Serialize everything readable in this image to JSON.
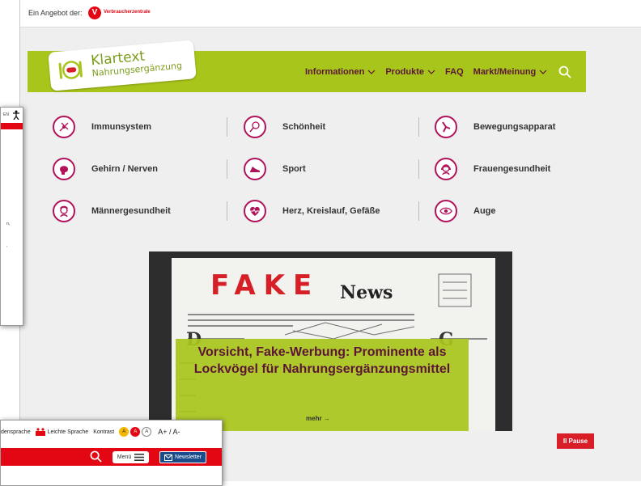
{
  "topbar": {
    "offer_text": "Ein Angebot der:",
    "org_name": "Verbraucherzentrale",
    "logo_letter": "V"
  },
  "header": {
    "logo_line1": "Klartext",
    "logo_line2": "Nahrungsergänzung",
    "brand_color": "#a8c51b",
    "nav": [
      {
        "label": "Informationen",
        "has_dropdown": true
      },
      {
        "label": "Produkte",
        "has_dropdown": true
      },
      {
        "label": "FAQ",
        "has_dropdown": false
      },
      {
        "label": "Markt/Meinung",
        "has_dropdown": true
      }
    ],
    "search_icon": "search-icon"
  },
  "categories": [
    {
      "label": "Immunsystem",
      "icon": "immune-icon"
    },
    {
      "label": "Schönheit",
      "icon": "beauty-icon"
    },
    {
      "label": "Bewegungsapparat",
      "icon": "joint-icon"
    },
    {
      "label": "Gehirn / Nerven",
      "icon": "brain-icon"
    },
    {
      "label": "Sport",
      "icon": "shoe-icon"
    },
    {
      "label": "Frauengesundheit",
      "icon": "woman-icon"
    },
    {
      "label": "Männergesundheit",
      "icon": "man-icon"
    },
    {
      "label": "Herz, Kreislauf, Gefäße",
      "icon": "heart-icon"
    },
    {
      "label": "Auge",
      "icon": "eye-icon"
    }
  ],
  "hero": {
    "image_word1": "FAKE",
    "image_word2": "News",
    "title": "Vorsicht, Fake-Werbung: Prominente als Lockvögel für Nahrungsergänzungsmittel",
    "more_label": "mehr →",
    "pause_label": "II  Pause"
  },
  "left_window": {
    "lang": "EN",
    "frag1": "n,",
    "frag2": ","
  },
  "bottom_window": {
    "tools": [
      "densprache",
      "Leichte Sprache",
      "Kontrast",
      "A+ / A-"
    ],
    "contrast_letters": [
      "A",
      "A",
      "A"
    ],
    "menu_label": "Menü",
    "newsletter_label": "Newsletter"
  }
}
